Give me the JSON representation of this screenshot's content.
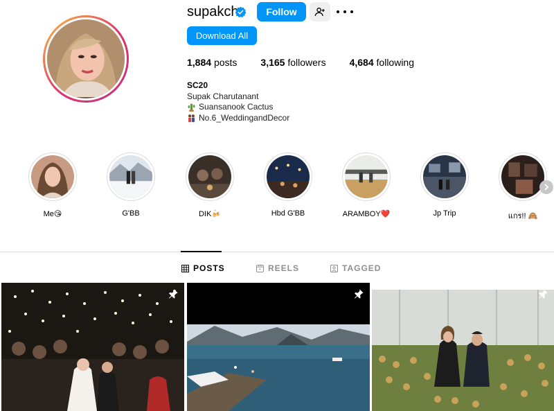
{
  "profile": {
    "username": "supakch",
    "verified_icon": "verified-badge-icon",
    "follow_label": "Follow",
    "download_label": "Download All",
    "stats": {
      "posts_count": "1,884",
      "posts_label": "posts",
      "followers_count": "3,165",
      "followers_label": "followers",
      "following_count": "4,684",
      "following_label": "following"
    },
    "bio": {
      "name": "SC20",
      "full_name": "Supak Charutanant",
      "line1": "Suansanook Cactus",
      "line2": "No.6_WeddingandDecor"
    },
    "accent_color": "#0095f6"
  },
  "highlights": [
    {
      "label": "Me😘"
    },
    {
      "label": "G'BB"
    },
    {
      "label": "DIK🍻"
    },
    {
      "label": "Hbd G'BB"
    },
    {
      "label": "ARAMBOY❤️"
    },
    {
      "label": "Jp Trip"
    },
    {
      "label": "แกร!! 🙈"
    }
  ],
  "tabs": [
    {
      "label": "POSTS",
      "icon": "grid-icon"
    },
    {
      "label": "REELS",
      "icon": "reels-icon"
    },
    {
      "label": "TAGGED",
      "icon": "tagged-icon"
    }
  ],
  "posts": [
    {
      "pinned": true,
      "icon": "pin-icon"
    },
    {
      "pinned": true,
      "icon": "pin-icon"
    },
    {
      "pinned": true,
      "icon": "pin-icon"
    }
  ]
}
